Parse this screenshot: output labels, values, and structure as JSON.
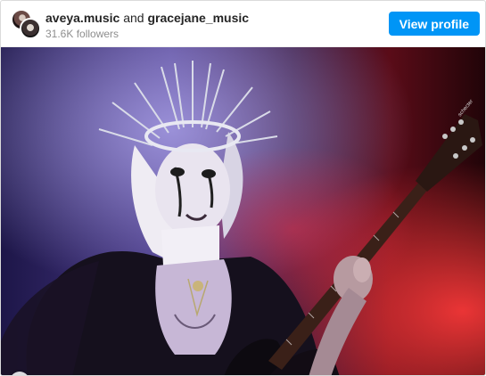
{
  "header": {
    "user1": "aveya.music",
    "conjunction": "and",
    "user2": "gracejane_music",
    "followers": "31.6K followers",
    "view_profile_label": "View profile"
  },
  "media": {
    "guitar_headstock_brand": "schecter",
    "nav_prev_icon": "chevron-left-icon"
  },
  "colors": {
    "accent": "#0095f6",
    "secondary_text": "#8e8e8e",
    "primary_text": "#262626"
  }
}
